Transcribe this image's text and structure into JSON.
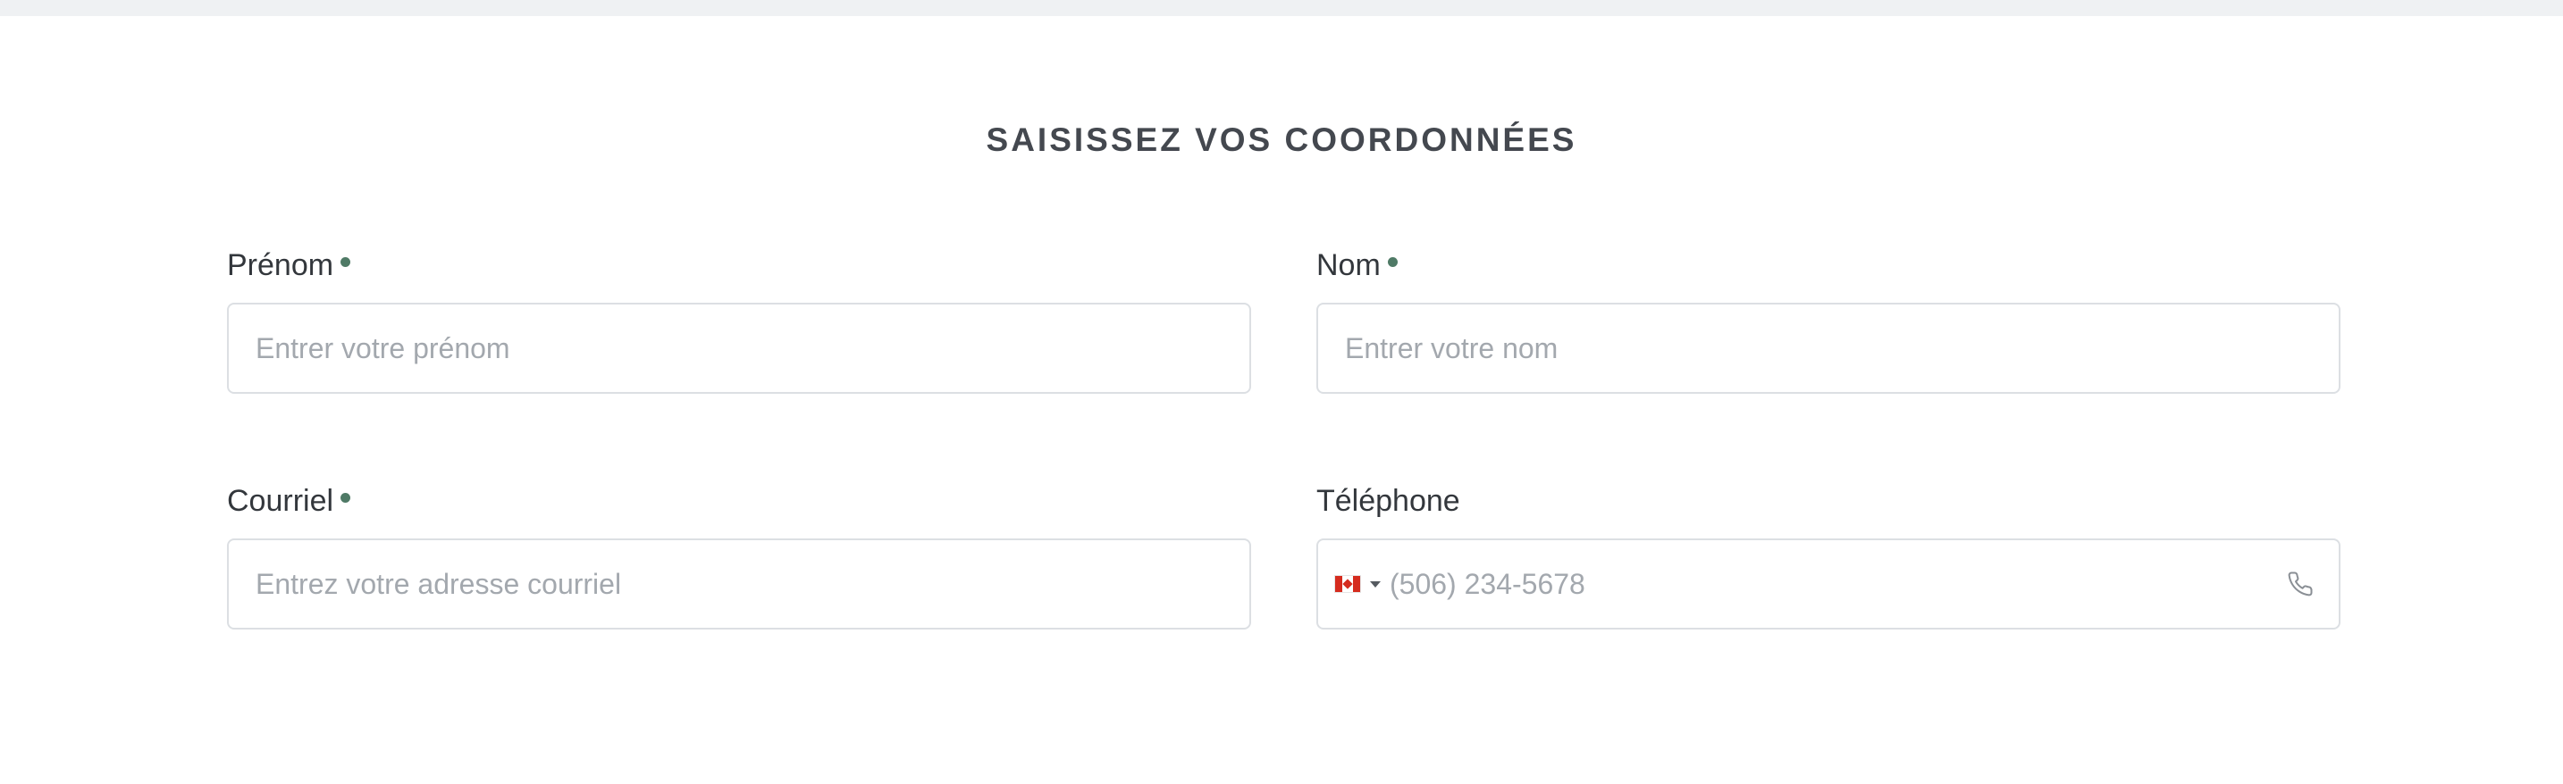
{
  "section_title": "SAISISSEZ VOS COORDONNÉES",
  "fields": {
    "first_name": {
      "label": "Prénom",
      "required": true,
      "placeholder": "Entrer votre prénom"
    },
    "last_name": {
      "label": "Nom",
      "required": true,
      "placeholder": "Entrer votre nom"
    },
    "email": {
      "label": "Courriel",
      "required": true,
      "placeholder": "Entrez votre adresse courriel"
    },
    "phone": {
      "label": "Téléphone",
      "required": false,
      "placeholder": "(506) 234-5678",
      "country_icon": "canada-flag-icon"
    }
  },
  "colors": {
    "required_dot": "#4f7a66",
    "top_bar": "#eff1f3",
    "input_border": "#dcdfe3",
    "placeholder": "#a3a8ae"
  }
}
